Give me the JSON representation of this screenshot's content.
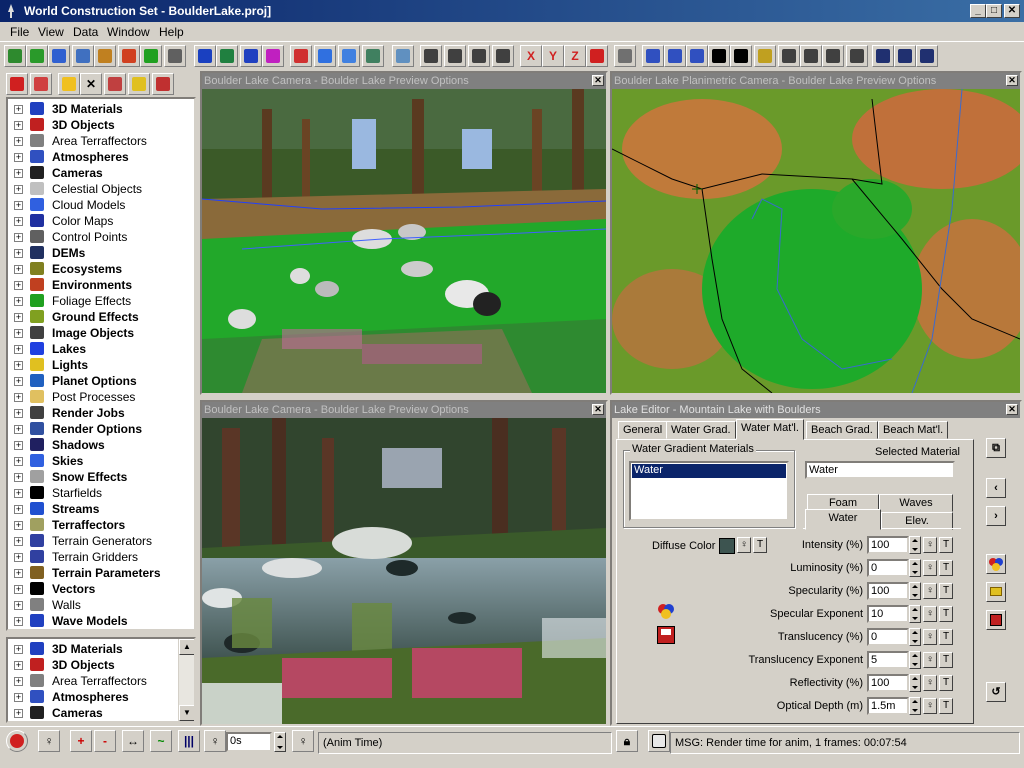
{
  "window": {
    "title": "World Construction Set - BoulderLake.proj]",
    "min_label": "_",
    "max_label": "□",
    "close_label": "✕"
  },
  "menu": [
    "File",
    "View",
    "Data",
    "Window",
    "Help"
  ],
  "toolbar_icons": [
    "terrain-icon",
    "tree-icon",
    "water-icon",
    "chart-icon",
    "animal-icon",
    "teapot-icon",
    "broom-icon",
    "camera-icon",
    "help-icon",
    "check-icon",
    "star-icon",
    "burst-icon",
    "palette-icon",
    "sky-icon",
    "cloud-icon",
    "road-icon",
    "image-icon",
    "move-icon",
    "rotate-icon",
    "scale-icon",
    "arrows-icon",
    "x-axis-icon",
    "y-axis-icon",
    "z-axis-icon",
    "updown-icon",
    "points-icon",
    "edit-point-icon",
    "edit-path-icon",
    "edit-smooth-icon",
    "delete-icon",
    "undo-icon",
    "add-point-icon",
    "zoom-in-icon",
    "zoom-out-icon",
    "zoom-fit-icon",
    "zoom-pan-icon",
    "layout1-icon",
    "layout2-icon",
    "layout3-icon"
  ],
  "toolbar_axis_labels": {
    "x": "X",
    "y": "Y",
    "z": "Z"
  },
  "database_tree": {
    "items": [
      {
        "label": "3D Materials",
        "bold": true,
        "icon": "materials-icon",
        "color": "#2040c0"
      },
      {
        "label": "3D Objects",
        "bold": true,
        "icon": "car-icon",
        "color": "#c02020"
      },
      {
        "label": "Area Terraffectors",
        "bold": false,
        "icon": "area-icon",
        "color": "#808080"
      },
      {
        "label": "Atmospheres",
        "bold": true,
        "icon": "atmosphere-icon",
        "color": "#3050c0"
      },
      {
        "label": "Cameras",
        "bold": true,
        "icon": "camera-tripod-icon",
        "color": "#202020"
      },
      {
        "label": "Celestial Objects",
        "bold": false,
        "icon": "moon-icon",
        "color": "#c0c0c0"
      },
      {
        "label": "Cloud Models",
        "bold": false,
        "icon": "cloud-icon",
        "color": "#3060e0"
      },
      {
        "label": "Color Maps",
        "bold": false,
        "icon": "colormap-icon",
        "color": "#2030a0"
      },
      {
        "label": "Control Points",
        "bold": false,
        "icon": "points-icon",
        "color": "#606060"
      },
      {
        "label": "DEMs",
        "bold": true,
        "icon": "dem-icon",
        "color": "#203060"
      },
      {
        "label": "Ecosystems",
        "bold": true,
        "icon": "ecosystem-icon",
        "color": "#808020"
      },
      {
        "label": "Environments",
        "bold": true,
        "icon": "environment-icon",
        "color": "#c04020"
      },
      {
        "label": "Foliage Effects",
        "bold": false,
        "icon": "foliage-icon",
        "color": "#20a020"
      },
      {
        "label": "Ground Effects",
        "bold": true,
        "icon": "ground-icon",
        "color": "#80a020"
      },
      {
        "label": "Image Objects",
        "bold": true,
        "icon": "image-object-icon",
        "color": "#404040"
      },
      {
        "label": "Lakes",
        "bold": true,
        "icon": "lake-icon",
        "color": "#2040e0"
      },
      {
        "label": "Lights",
        "bold": true,
        "icon": "light-icon",
        "color": "#e0c020"
      },
      {
        "label": "Planet Options",
        "bold": true,
        "icon": "planet-icon",
        "color": "#2060c0"
      },
      {
        "label": "Post Processes",
        "bold": false,
        "icon": "post-icon",
        "color": "#e0c060"
      },
      {
        "label": "Render Jobs",
        "bold": true,
        "icon": "render-job-icon",
        "color": "#404040"
      },
      {
        "label": "Render Options",
        "bold": true,
        "icon": "render-options-icon",
        "color": "#3050a0"
      },
      {
        "label": "Shadows",
        "bold": true,
        "icon": "shadow-icon",
        "color": "#202060"
      },
      {
        "label": "Skies",
        "bold": true,
        "icon": "sky-icon",
        "color": "#3060e0"
      },
      {
        "label": "Snow Effects",
        "bold": true,
        "icon": "snow-icon",
        "color": "#a0a0a0"
      },
      {
        "label": "Starfields",
        "bold": false,
        "icon": "starfield-icon",
        "color": "#000000"
      },
      {
        "label": "Streams",
        "bold": true,
        "icon": "stream-icon",
        "color": "#2050d0"
      },
      {
        "label": "Terraffectors",
        "bold": true,
        "icon": "terraffector-icon",
        "color": "#a0a060"
      },
      {
        "label": "Terrain Generators",
        "bold": false,
        "icon": "generator-icon",
        "color": "#3040a0"
      },
      {
        "label": "Terrain Gridders",
        "bold": false,
        "icon": "gridder-icon",
        "color": "#3040a0"
      },
      {
        "label": "Terrain Parameters",
        "bold": true,
        "icon": "terrain-param-icon",
        "color": "#806020"
      },
      {
        "label": "Vectors",
        "bold": true,
        "icon": "vector-icon",
        "color": "#000000"
      },
      {
        "label": "Walls",
        "bold": false,
        "icon": "wall-icon",
        "color": "#808080"
      },
      {
        "label": "Wave Models",
        "bold": true,
        "icon": "wave-icon",
        "color": "#2040c0"
      }
    ]
  },
  "lower_tree": {
    "items": [
      {
        "label": "3D Materials",
        "bold": true,
        "icon": "materials-icon",
        "color": "#2040c0"
      },
      {
        "label": "3D Objects",
        "bold": true,
        "icon": "car-icon",
        "color": "#c02020"
      },
      {
        "label": "Area Terraffectors",
        "bold": false,
        "icon": "area-icon",
        "color": "#808080"
      },
      {
        "label": "Atmospheres",
        "bold": true,
        "icon": "atmosphere-icon",
        "color": "#3050c0"
      },
      {
        "label": "Cameras",
        "bold": true,
        "icon": "camera-tripod-icon",
        "color": "#202020"
      }
    ]
  },
  "views": [
    {
      "title": "Boulder Lake Camera - Boulder Lake Preview Options",
      "kind": "preview"
    },
    {
      "title": "Boulder Lake Planimetric Camera - Boulder Lake Preview Options",
      "kind": "planimetric"
    },
    {
      "title": "Boulder Lake Camera - Boulder Lake Preview Options",
      "kind": "render"
    }
  ],
  "editor": {
    "title": "Lake Editor - Mountain Lake with Boulders",
    "tabs": [
      "General",
      "Water Grad.",
      "Water Mat'l.",
      "Beach Grad.",
      "Beach Mat'l."
    ],
    "selected_tab": "Water Mat'l.",
    "gradient_group_label": "Water Gradient Materials",
    "gradient_items": [
      "Water"
    ],
    "selected_material_label": "Selected Material",
    "selected_material_value": "Water",
    "subtabs_top": [
      "Foam",
      "Waves"
    ],
    "subtabs_bottom": [
      "Water",
      "Elev."
    ],
    "diffuse_label": "Diffuse Color",
    "diffuse_color": "#3d5450",
    "params": [
      {
        "label": "Intensity (%)",
        "value": "100"
      },
      {
        "label": "Luminosity (%)",
        "value": "0"
      },
      {
        "label": "Specularity (%)",
        "value": "100"
      },
      {
        "label": "Specular Exponent",
        "value": "10"
      },
      {
        "label": "Translucency (%)",
        "value": "0"
      },
      {
        "label": "Translucency Exponent",
        "value": "5"
      },
      {
        "label": "Reflectivity (%)",
        "value": "100"
      },
      {
        "label": "Optical Depth (m)",
        "value": "1.5m"
      }
    ]
  },
  "status": {
    "time_value": "0s",
    "anim_label": "(Anim Time)",
    "message": "MSG: Render time for anim, 1 frames:  00:07:54"
  },
  "colors": {
    "title_bar_start": "#0a246a",
    "title_bar_end": "#3a6ea5",
    "selection": "#0a246a",
    "face": "#d4d0c8"
  }
}
